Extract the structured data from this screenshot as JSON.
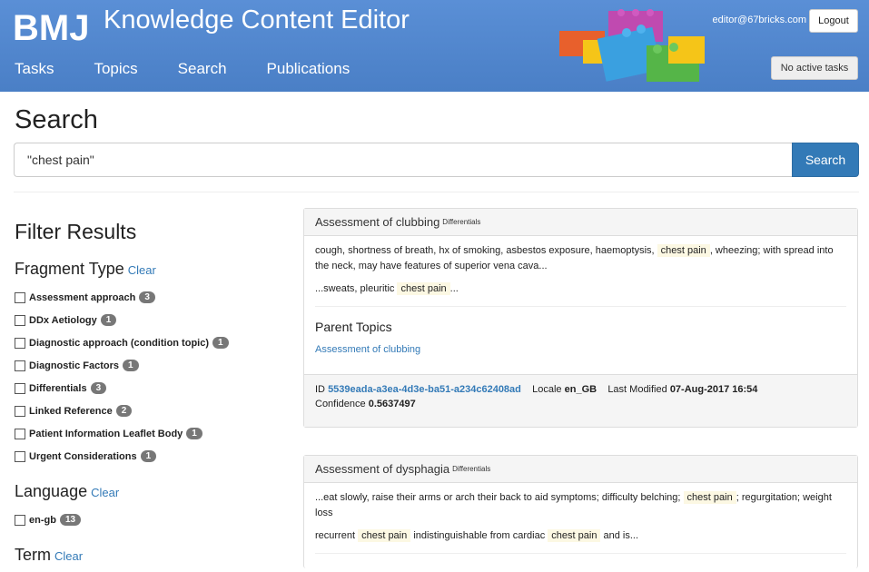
{
  "header": {
    "logo_text": "BMJ",
    "app_title": "Knowledge Content Editor",
    "nav": [
      "Tasks",
      "Topics",
      "Search",
      "Publications"
    ],
    "user_email": "editor@67bricks.com",
    "logout_label": "Logout",
    "tasks_status": "No active tasks"
  },
  "search": {
    "title": "Search",
    "query": "\"chest pain\"",
    "button_label": "Search"
  },
  "filters": {
    "title": "Filter Results",
    "clear_label": "Clear",
    "fragment_type": {
      "title": "Fragment Type",
      "items": [
        {
          "label": "Assessment approach",
          "count": "3"
        },
        {
          "label": "DDx Aetiology",
          "count": "1"
        },
        {
          "label": "Diagnostic approach (condition topic)",
          "count": "1"
        },
        {
          "label": "Diagnostic Factors",
          "count": "1"
        },
        {
          "label": "Differentials",
          "count": "3"
        },
        {
          "label": "Linked Reference",
          "count": "2"
        },
        {
          "label": "Patient Information Leaflet Body",
          "count": "1"
        },
        {
          "label": "Urgent Considerations",
          "count": "1"
        }
      ]
    },
    "language": {
      "title": "Language",
      "items": [
        {
          "label": "en-gb",
          "count": "13"
        }
      ]
    },
    "term": {
      "title": "Term"
    }
  },
  "results": [
    {
      "title": "Assessment of clubbing",
      "type": "Differentials",
      "snippet1_pre": "cough, shortness of breath, hx of smoking, asbestos exposure, haemoptysis,",
      "snippet1_hl": "chest pain",
      "snippet1_post": ", wheezing; with spread into the neck, may have features of superior vena cava...",
      "snippet2_pre": "...sweats, pleuritic",
      "snippet2_hl": "chest pain",
      "snippet2_post": "...",
      "parent_title": "Parent Topics",
      "parent_link": "Assessment of clubbing",
      "id_label": "ID",
      "id": "5539eada-a3ea-4d3e-ba51-a234c62408ad",
      "locale_label": "Locale",
      "locale": "en_GB",
      "modified_label": "Last Modified",
      "modified": "07-Aug-2017 16:54",
      "confidence_label": "Confidence",
      "confidence": "0.5637497"
    },
    {
      "title": "Assessment of dysphagia",
      "type": "Differentials",
      "snippet1_pre": "...eat slowly, raise their arms or arch their back to aid symptoms; difficulty belching;",
      "snippet1_hl": "chest pain",
      "snippet1_post": "; regurgitation; weight loss",
      "snippet2_pre": "recurrent",
      "snippet2_hl": "chest pain",
      "snippet2_mid": "indistinguishable from cardiac",
      "snippet2_hl2": "chest pain",
      "snippet2_post": "and is..."
    }
  ]
}
